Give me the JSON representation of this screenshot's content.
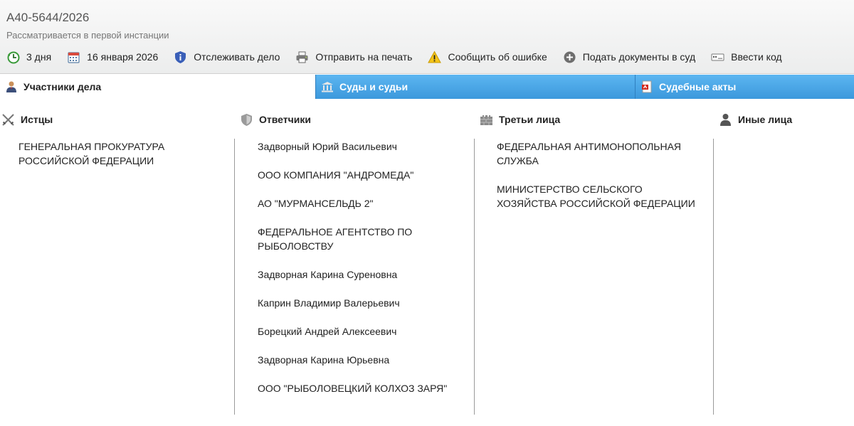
{
  "case": {
    "number": "А40-5644/2026",
    "status": "Рассматривается в первой инстанции"
  },
  "toolbar": [
    {
      "label": "3 дня",
      "icon": "clock-icon"
    },
    {
      "label": "16 января 2026",
      "icon": "calendar-icon"
    },
    {
      "label": "Отслеживать дело",
      "icon": "shield-icon"
    },
    {
      "label": "Отправить на печать",
      "icon": "printer-icon"
    },
    {
      "label": "Сообщить об ошибке",
      "icon": "warning-icon"
    },
    {
      "label": "Подать документы в суд",
      "icon": "plus-circle-icon"
    },
    {
      "label": "Ввести код",
      "icon": "keyboard-icon"
    }
  ],
  "tabs": [
    {
      "label": "Участники дела",
      "icon": "user-suit-icon",
      "active": true
    },
    {
      "label": "Суды и судьи",
      "icon": "courthouse-icon",
      "active": false
    },
    {
      "label": "Судебные акты",
      "icon": "pdf-document-icon",
      "active": false
    }
  ],
  "columns": [
    {
      "title": "Истцы",
      "icon": "crossed-swords-icon",
      "items": [
        "ГЕНЕРАЛЬНАЯ ПРОКУРАТУРА РОССИЙСКОЙ ФЕДЕРАЦИИ"
      ]
    },
    {
      "title": "Ответчики",
      "icon": "shield-icon",
      "items": [
        "Задворный Юрий Васильевич",
        "ООО КОМПАНИЯ \"АНДРОМЕДА\"",
        "АО \"МУРМАНСЕЛЬДЬ 2\"",
        "ФЕДЕРАЛЬНОЕ АГЕНТСТВО ПО РЫБОЛОВСТВУ",
        "Задворная Карина Суреновна",
        "Каприн Владимир Валерьевич",
        "Борецкий Андрей Алексеевич",
        "Задворная Карина Юрьевна",
        "ООО \"РЫБОЛОВЕЦКИЙ КОЛХОЗ ЗАРЯ\""
      ]
    },
    {
      "title": "Третьи лица",
      "icon": "castle-wall-icon",
      "items": [
        "ФЕДЕРАЛЬНАЯ АНТИМОНОПОЛЬНАЯ СЛУЖБА",
        "МИНИСТЕРСТВО СЕЛЬСКОГО ХОЗЯЙСТВА РОССИЙСКОЙ ФЕДЕРАЦИИ"
      ]
    },
    {
      "title": "Иные лица",
      "icon": "person-icon",
      "items": []
    }
  ],
  "colors": {
    "tab_blue": "#3c98dc",
    "header_bg": "#eceded",
    "divider": "#9a9a9a"
  }
}
